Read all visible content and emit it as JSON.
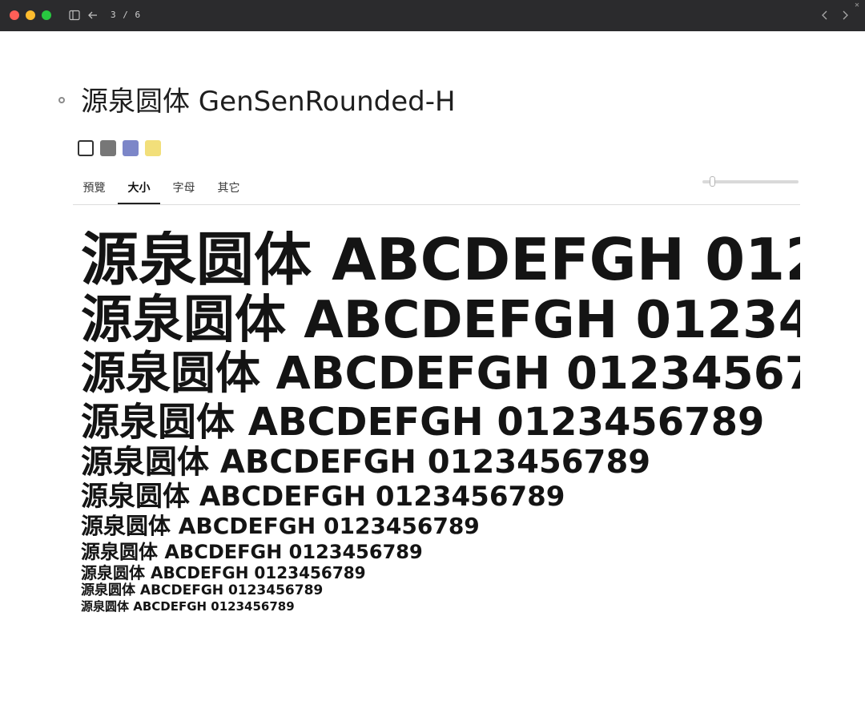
{
  "titlebar": {
    "page_counter": "3 / 6",
    "traffic_colors": [
      "#ff5f57",
      "#febc2e",
      "#28c840"
    ]
  },
  "header": {
    "title": "源泉圆体 GenSenRounded-H",
    "swatches": [
      {
        "name": "white",
        "color": "#ffffff",
        "border": "#333333"
      },
      {
        "name": "gray",
        "color": "#777777",
        "border": "#777777"
      },
      {
        "name": "periwinkle",
        "color": "#7c86c8",
        "border": "#7c86c8"
      },
      {
        "name": "yellow",
        "color": "#f2df7a",
        "border": "#f2df7a"
      }
    ]
  },
  "tabs": [
    {
      "label": "預覽",
      "active": false
    },
    {
      "label": "大小",
      "active": true
    },
    {
      "label": "字母",
      "active": false
    },
    {
      "label": "其它",
      "active": false
    }
  ],
  "slider": {
    "value": 0.08
  },
  "samples": {
    "text": "源泉圆体 ABCDEFGH 0123456789",
    "sizes": [
      72,
      64,
      56,
      48,
      40,
      34,
      28,
      24,
      20,
      17,
      15
    ]
  }
}
